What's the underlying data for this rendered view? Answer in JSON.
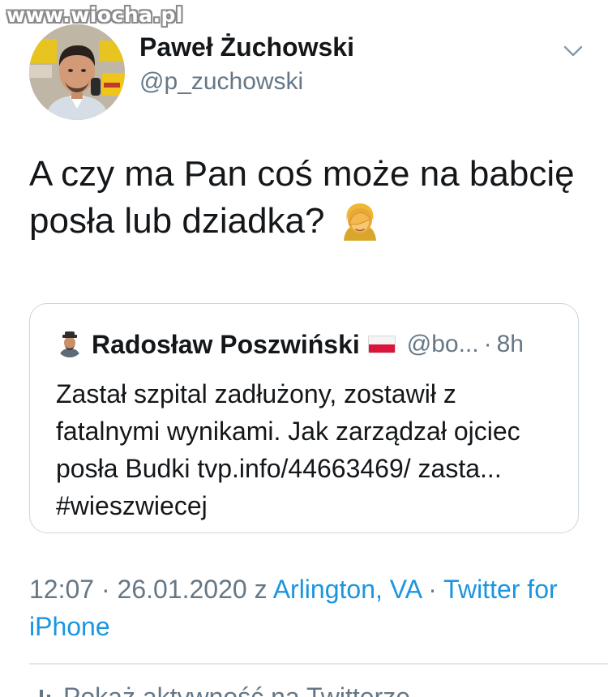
{
  "watermark": "www.wiocha.pl",
  "author": {
    "name": "Paweł Żuchowski",
    "handle": "@p_zuchowski",
    "avatar_icon": "user-avatar-photo"
  },
  "tweet": {
    "text": "A czy ma Pan coś może na babcię posła lub dziadka?",
    "emoji_icon": "facepalm-emoji"
  },
  "quote": {
    "name": "Radosław Poszwiński",
    "flag_icon": "poland-flag",
    "handle": "@bo...",
    "separator": "·",
    "time": "8h",
    "text": "Zastał szpital zadłużony, zostawił z fatalnymi wynikami. Jak zarządzał ojciec posła Budki tvp.info/44663469/ zasta... #wieszwiecej"
  },
  "meta": {
    "time": "12:07",
    "sep1": "·",
    "date": "26.01.2020",
    "z": "z",
    "location": "Arlington, VA",
    "sep2": "·",
    "source": "Twitter for iPhone"
  },
  "activity": {
    "label": "Pokaż aktywność na Twitterze"
  },
  "colors": {
    "link": "#1b95e0",
    "secondary": "#657786",
    "primary_text": "#14171a",
    "border": "#ccd6dd"
  }
}
